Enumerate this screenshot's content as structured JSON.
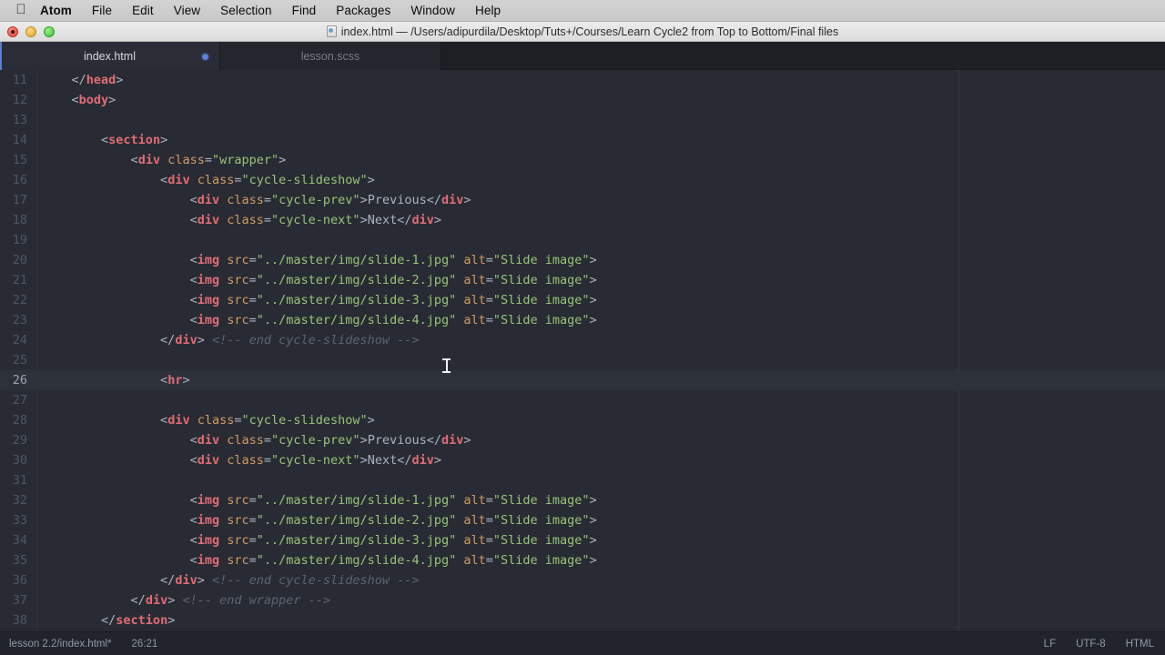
{
  "menubar": {
    "apple_icon": "apple-logo-icon",
    "items": [
      {
        "label": "Atom",
        "bold": true
      },
      {
        "label": "File"
      },
      {
        "label": "Edit"
      },
      {
        "label": "View"
      },
      {
        "label": "Selection"
      },
      {
        "label": "Find"
      },
      {
        "label": "Packages"
      },
      {
        "label": "Window"
      },
      {
        "label": "Help"
      }
    ]
  },
  "window": {
    "title": "index.html — /Users/adipurdila/Desktop/Tuts+/Courses/Learn Cycle2 from Top to Bottom/Final files",
    "traffic_lights": [
      "close",
      "minimize",
      "maximize"
    ]
  },
  "tabs": [
    {
      "label": "index.html",
      "active": true,
      "modified": true
    },
    {
      "label": "lesson.scss",
      "active": false,
      "modified": false
    }
  ],
  "editor": {
    "first_line": 11,
    "active_line": 26,
    "wrap_guide_column": 120,
    "cursor_position": "26:21",
    "lines": [
      {
        "n": 11,
        "tokens": [
          {
            "t": "punct",
            "v": "    "
          },
          {
            "t": "punct",
            "v": "</"
          },
          {
            "t": "tag",
            "v": "head"
          },
          {
            "t": "punct",
            "v": ">"
          }
        ]
      },
      {
        "n": 12,
        "tokens": [
          {
            "t": "punct",
            "v": "    "
          },
          {
            "t": "punct",
            "v": "<"
          },
          {
            "t": "tag",
            "v": "body"
          },
          {
            "t": "punct",
            "v": ">"
          }
        ]
      },
      {
        "n": 13,
        "tokens": []
      },
      {
        "n": 14,
        "tokens": [
          {
            "t": "punct",
            "v": "        "
          },
          {
            "t": "punct",
            "v": "<"
          },
          {
            "t": "tag",
            "v": "section"
          },
          {
            "t": "punct",
            "v": ">"
          }
        ]
      },
      {
        "n": 15,
        "tokens": [
          {
            "t": "punct",
            "v": "            "
          },
          {
            "t": "punct",
            "v": "<"
          },
          {
            "t": "tag",
            "v": "div"
          },
          {
            "t": "punct",
            "v": " "
          },
          {
            "t": "attr",
            "v": "class"
          },
          {
            "t": "eq",
            "v": "="
          },
          {
            "t": "string",
            "v": "\"wrapper\""
          },
          {
            "t": "punct",
            "v": ">"
          }
        ]
      },
      {
        "n": 16,
        "tokens": [
          {
            "t": "punct",
            "v": "                "
          },
          {
            "t": "punct",
            "v": "<"
          },
          {
            "t": "tag",
            "v": "div"
          },
          {
            "t": "punct",
            "v": " "
          },
          {
            "t": "attr",
            "v": "class"
          },
          {
            "t": "eq",
            "v": "="
          },
          {
            "t": "string",
            "v": "\"cycle-slideshow\""
          },
          {
            "t": "punct",
            "v": ">"
          }
        ]
      },
      {
        "n": 17,
        "tokens": [
          {
            "t": "punct",
            "v": "                    "
          },
          {
            "t": "punct",
            "v": "<"
          },
          {
            "t": "tag",
            "v": "div"
          },
          {
            "t": "punct",
            "v": " "
          },
          {
            "t": "attr",
            "v": "class"
          },
          {
            "t": "eq",
            "v": "="
          },
          {
            "t": "string",
            "v": "\"cycle-prev\""
          },
          {
            "t": "punct",
            "v": ">"
          },
          {
            "t": "text",
            "v": "Previous"
          },
          {
            "t": "punct",
            "v": "</"
          },
          {
            "t": "tag",
            "v": "div"
          },
          {
            "t": "punct",
            "v": ">"
          }
        ]
      },
      {
        "n": 18,
        "tokens": [
          {
            "t": "punct",
            "v": "                    "
          },
          {
            "t": "punct",
            "v": "<"
          },
          {
            "t": "tag",
            "v": "div"
          },
          {
            "t": "punct",
            "v": " "
          },
          {
            "t": "attr",
            "v": "class"
          },
          {
            "t": "eq",
            "v": "="
          },
          {
            "t": "string",
            "v": "\"cycle-next\""
          },
          {
            "t": "punct",
            "v": ">"
          },
          {
            "t": "text",
            "v": "Next"
          },
          {
            "t": "punct",
            "v": "</"
          },
          {
            "t": "tag",
            "v": "div"
          },
          {
            "t": "punct",
            "v": ">"
          }
        ]
      },
      {
        "n": 19,
        "tokens": []
      },
      {
        "n": 20,
        "tokens": [
          {
            "t": "punct",
            "v": "                    "
          },
          {
            "t": "punct",
            "v": "<"
          },
          {
            "t": "tag",
            "v": "img"
          },
          {
            "t": "punct",
            "v": " "
          },
          {
            "t": "attr",
            "v": "src"
          },
          {
            "t": "eq",
            "v": "="
          },
          {
            "t": "string",
            "v": "\"../master/img/slide-1.jpg\""
          },
          {
            "t": "punct",
            "v": " "
          },
          {
            "t": "attr",
            "v": "alt"
          },
          {
            "t": "eq",
            "v": "="
          },
          {
            "t": "string",
            "v": "\"Slide image\""
          },
          {
            "t": "punct",
            "v": ">"
          }
        ]
      },
      {
        "n": 21,
        "tokens": [
          {
            "t": "punct",
            "v": "                    "
          },
          {
            "t": "punct",
            "v": "<"
          },
          {
            "t": "tag",
            "v": "img"
          },
          {
            "t": "punct",
            "v": " "
          },
          {
            "t": "attr",
            "v": "src"
          },
          {
            "t": "eq",
            "v": "="
          },
          {
            "t": "string",
            "v": "\"../master/img/slide-2.jpg\""
          },
          {
            "t": "punct",
            "v": " "
          },
          {
            "t": "attr",
            "v": "alt"
          },
          {
            "t": "eq",
            "v": "="
          },
          {
            "t": "string",
            "v": "\"Slide image\""
          },
          {
            "t": "punct",
            "v": ">"
          }
        ]
      },
      {
        "n": 22,
        "tokens": [
          {
            "t": "punct",
            "v": "                    "
          },
          {
            "t": "punct",
            "v": "<"
          },
          {
            "t": "tag",
            "v": "img"
          },
          {
            "t": "punct",
            "v": " "
          },
          {
            "t": "attr",
            "v": "src"
          },
          {
            "t": "eq",
            "v": "="
          },
          {
            "t": "string",
            "v": "\"../master/img/slide-3.jpg\""
          },
          {
            "t": "punct",
            "v": " "
          },
          {
            "t": "attr",
            "v": "alt"
          },
          {
            "t": "eq",
            "v": "="
          },
          {
            "t": "string",
            "v": "\"Slide image\""
          },
          {
            "t": "punct",
            "v": ">"
          }
        ]
      },
      {
        "n": 23,
        "tokens": [
          {
            "t": "punct",
            "v": "                    "
          },
          {
            "t": "punct",
            "v": "<"
          },
          {
            "t": "tag",
            "v": "img"
          },
          {
            "t": "punct",
            "v": " "
          },
          {
            "t": "attr",
            "v": "src"
          },
          {
            "t": "eq",
            "v": "="
          },
          {
            "t": "string",
            "v": "\"../master/img/slide-4.jpg\""
          },
          {
            "t": "punct",
            "v": " "
          },
          {
            "t": "attr",
            "v": "alt"
          },
          {
            "t": "eq",
            "v": "="
          },
          {
            "t": "string",
            "v": "\"Slide image\""
          },
          {
            "t": "punct",
            "v": ">"
          }
        ]
      },
      {
        "n": 24,
        "tokens": [
          {
            "t": "punct",
            "v": "                "
          },
          {
            "t": "punct",
            "v": "</"
          },
          {
            "t": "tag",
            "v": "div"
          },
          {
            "t": "punct",
            "v": ">"
          },
          {
            "t": "punct",
            "v": " "
          },
          {
            "t": "comment",
            "v": "<!-- end cycle-slideshow -->"
          }
        ]
      },
      {
        "n": 25,
        "tokens": []
      },
      {
        "n": 26,
        "tokens": [
          {
            "t": "punct",
            "v": "                "
          },
          {
            "t": "punct",
            "v": "<"
          },
          {
            "t": "tag",
            "v": "hr"
          },
          {
            "t": "punct",
            "v": ">"
          }
        ]
      },
      {
        "n": 27,
        "tokens": []
      },
      {
        "n": 28,
        "tokens": [
          {
            "t": "punct",
            "v": "                "
          },
          {
            "t": "punct",
            "v": "<"
          },
          {
            "t": "tag",
            "v": "div"
          },
          {
            "t": "punct",
            "v": " "
          },
          {
            "t": "attr",
            "v": "class"
          },
          {
            "t": "eq",
            "v": "="
          },
          {
            "t": "string",
            "v": "\"cycle-slideshow\""
          },
          {
            "t": "punct",
            "v": ">"
          }
        ]
      },
      {
        "n": 29,
        "tokens": [
          {
            "t": "punct",
            "v": "                    "
          },
          {
            "t": "punct",
            "v": "<"
          },
          {
            "t": "tag",
            "v": "div"
          },
          {
            "t": "punct",
            "v": " "
          },
          {
            "t": "attr",
            "v": "class"
          },
          {
            "t": "eq",
            "v": "="
          },
          {
            "t": "string",
            "v": "\"cycle-prev\""
          },
          {
            "t": "punct",
            "v": ">"
          },
          {
            "t": "text",
            "v": "Previous"
          },
          {
            "t": "punct",
            "v": "</"
          },
          {
            "t": "tag",
            "v": "div"
          },
          {
            "t": "punct",
            "v": ">"
          }
        ]
      },
      {
        "n": 30,
        "tokens": [
          {
            "t": "punct",
            "v": "                    "
          },
          {
            "t": "punct",
            "v": "<"
          },
          {
            "t": "tag",
            "v": "div"
          },
          {
            "t": "punct",
            "v": " "
          },
          {
            "t": "attr",
            "v": "class"
          },
          {
            "t": "eq",
            "v": "="
          },
          {
            "t": "string",
            "v": "\"cycle-next\""
          },
          {
            "t": "punct",
            "v": ">"
          },
          {
            "t": "text",
            "v": "Next"
          },
          {
            "t": "punct",
            "v": "</"
          },
          {
            "t": "tag",
            "v": "div"
          },
          {
            "t": "punct",
            "v": ">"
          }
        ]
      },
      {
        "n": 31,
        "tokens": []
      },
      {
        "n": 32,
        "tokens": [
          {
            "t": "punct",
            "v": "                    "
          },
          {
            "t": "punct",
            "v": "<"
          },
          {
            "t": "tag",
            "v": "img"
          },
          {
            "t": "punct",
            "v": " "
          },
          {
            "t": "attr",
            "v": "src"
          },
          {
            "t": "eq",
            "v": "="
          },
          {
            "t": "string",
            "v": "\"../master/img/slide-1.jpg\""
          },
          {
            "t": "punct",
            "v": " "
          },
          {
            "t": "attr",
            "v": "alt"
          },
          {
            "t": "eq",
            "v": "="
          },
          {
            "t": "string",
            "v": "\"Slide image\""
          },
          {
            "t": "punct",
            "v": ">"
          }
        ]
      },
      {
        "n": 33,
        "tokens": [
          {
            "t": "punct",
            "v": "                    "
          },
          {
            "t": "punct",
            "v": "<"
          },
          {
            "t": "tag",
            "v": "img"
          },
          {
            "t": "punct",
            "v": " "
          },
          {
            "t": "attr",
            "v": "src"
          },
          {
            "t": "eq",
            "v": "="
          },
          {
            "t": "string",
            "v": "\"../master/img/slide-2.jpg\""
          },
          {
            "t": "punct",
            "v": " "
          },
          {
            "t": "attr",
            "v": "alt"
          },
          {
            "t": "eq",
            "v": "="
          },
          {
            "t": "string",
            "v": "\"Slide image\""
          },
          {
            "t": "punct",
            "v": ">"
          }
        ]
      },
      {
        "n": 34,
        "tokens": [
          {
            "t": "punct",
            "v": "                    "
          },
          {
            "t": "punct",
            "v": "<"
          },
          {
            "t": "tag",
            "v": "img"
          },
          {
            "t": "punct",
            "v": " "
          },
          {
            "t": "attr",
            "v": "src"
          },
          {
            "t": "eq",
            "v": "="
          },
          {
            "t": "string",
            "v": "\"../master/img/slide-3.jpg\""
          },
          {
            "t": "punct",
            "v": " "
          },
          {
            "t": "attr",
            "v": "alt"
          },
          {
            "t": "eq",
            "v": "="
          },
          {
            "t": "string",
            "v": "\"Slide image\""
          },
          {
            "t": "punct",
            "v": ">"
          }
        ]
      },
      {
        "n": 35,
        "tokens": [
          {
            "t": "punct",
            "v": "                    "
          },
          {
            "t": "punct",
            "v": "<"
          },
          {
            "t": "tag",
            "v": "img"
          },
          {
            "t": "punct",
            "v": " "
          },
          {
            "t": "attr",
            "v": "src"
          },
          {
            "t": "eq",
            "v": "="
          },
          {
            "t": "string",
            "v": "\"../master/img/slide-4.jpg\""
          },
          {
            "t": "punct",
            "v": " "
          },
          {
            "t": "attr",
            "v": "alt"
          },
          {
            "t": "eq",
            "v": "="
          },
          {
            "t": "string",
            "v": "\"Slide image\""
          },
          {
            "t": "punct",
            "v": ">"
          }
        ]
      },
      {
        "n": 36,
        "tokens": [
          {
            "t": "punct",
            "v": "                "
          },
          {
            "t": "punct",
            "v": "</"
          },
          {
            "t": "tag",
            "v": "div"
          },
          {
            "t": "punct",
            "v": ">"
          },
          {
            "t": "punct",
            "v": " "
          },
          {
            "t": "comment",
            "v": "<!-- end cycle-slideshow -->"
          }
        ]
      },
      {
        "n": 37,
        "tokens": [
          {
            "t": "punct",
            "v": "            "
          },
          {
            "t": "punct",
            "v": "</"
          },
          {
            "t": "tag",
            "v": "div"
          },
          {
            "t": "punct",
            "v": ">"
          },
          {
            "t": "punct",
            "v": " "
          },
          {
            "t": "comment",
            "v": "<!-- end wrapper -->"
          }
        ]
      },
      {
        "n": 38,
        "tokens": [
          {
            "t": "punct",
            "v": "        "
          },
          {
            "t": "punct",
            "v": "</"
          },
          {
            "t": "tag",
            "v": "section"
          },
          {
            "t": "punct",
            "v": ">"
          }
        ]
      }
    ]
  },
  "statusbar": {
    "file_path": "lesson 2.2/index.html*",
    "cursor": "26:21",
    "line_ending": "LF",
    "encoding": "UTF-8",
    "grammar": "HTML"
  },
  "colors": {
    "editor_background": "#282b33",
    "tabbar_background": "#1d1f25",
    "active_tab_background": "#2a2d35",
    "statusbar_background": "#21242b",
    "menubar_background": "#d0d0d0",
    "accent_blue": "#5b7fdb",
    "tag_red": "#e06c75",
    "attribute_orange": "#d19a66",
    "string_green": "#98c379",
    "comment_gray": "#5c6370",
    "default_text": "#abb2bf",
    "line_number": "#4f5663"
  }
}
